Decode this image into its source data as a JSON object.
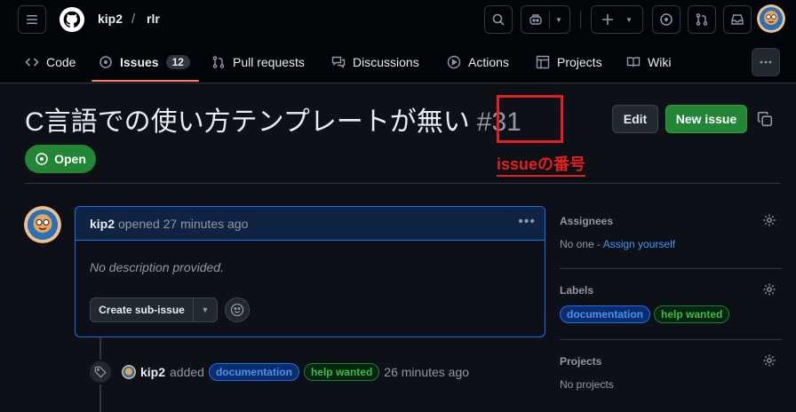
{
  "repo": {
    "owner": "kip2",
    "separator": "/",
    "name": "rlr"
  },
  "tabs": [
    {
      "label": "Code"
    },
    {
      "label": "Issues",
      "count": "12"
    },
    {
      "label": "Pull requests"
    },
    {
      "label": "Discussions"
    },
    {
      "label": "Actions"
    },
    {
      "label": "Projects"
    },
    {
      "label": "Wiki"
    }
  ],
  "issue": {
    "title": "C言語での使い方テンプレートが無い",
    "number": "#31",
    "state": "Open",
    "edit_label": "Edit",
    "new_issue_label": "New issue"
  },
  "annotation": {
    "text": "issueの番号",
    "color": "#e3201b"
  },
  "comment": {
    "author": "kip2",
    "meta": "opened 27 minutes ago",
    "body": "No description provided.",
    "subissue_label": "Create sub-issue"
  },
  "event": {
    "author": "kip2",
    "action": "added",
    "labels": [
      "documentation",
      "help wanted"
    ],
    "time": "26 minutes ago"
  },
  "sidebar": {
    "assignees": {
      "heading": "Assignees",
      "value": "No one - ",
      "link": "Assign yourself"
    },
    "labels": {
      "heading": "Labels",
      "items": [
        "documentation",
        "help wanted"
      ]
    },
    "projects": {
      "heading": "Projects",
      "value": "No projects"
    }
  },
  "colors": {
    "accent": "#f78166",
    "open": "#238636",
    "link": "#4493f8"
  }
}
